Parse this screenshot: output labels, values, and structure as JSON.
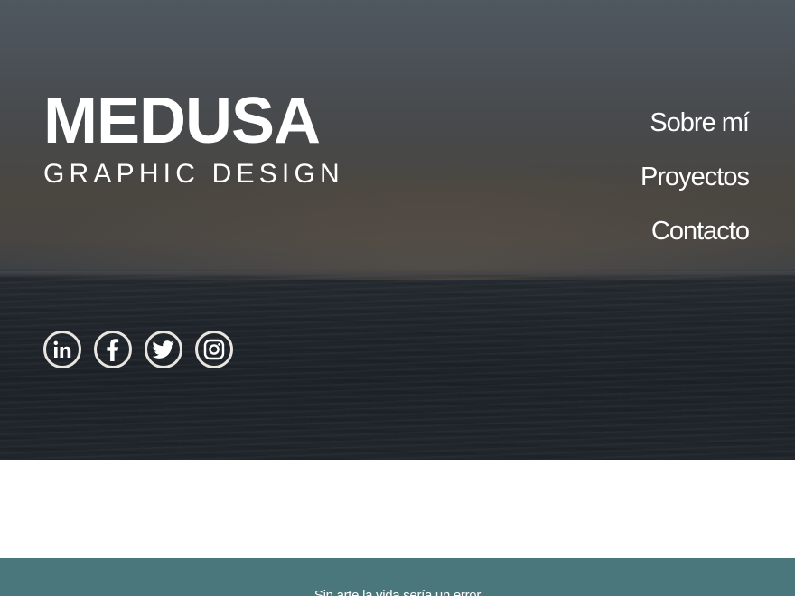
{
  "brand": {
    "title": "MEDUSA",
    "subtitle": "GRAPHIC DESIGN"
  },
  "nav": {
    "items": [
      {
        "label": "Sobre mí"
      },
      {
        "label": "Proyectos"
      },
      {
        "label": "Contacto"
      }
    ]
  },
  "social": {
    "icons": [
      "linkedin-icon",
      "facebook-icon",
      "twitter-icon",
      "instagram-icon"
    ]
  },
  "footer": {
    "quote": "Sin arte la vida sería un error"
  },
  "colors": {
    "text": "#ffffff",
    "icon_border": "#e9e6e0",
    "footer_bg": "#4a777b",
    "page_bg": "#ffffff"
  }
}
